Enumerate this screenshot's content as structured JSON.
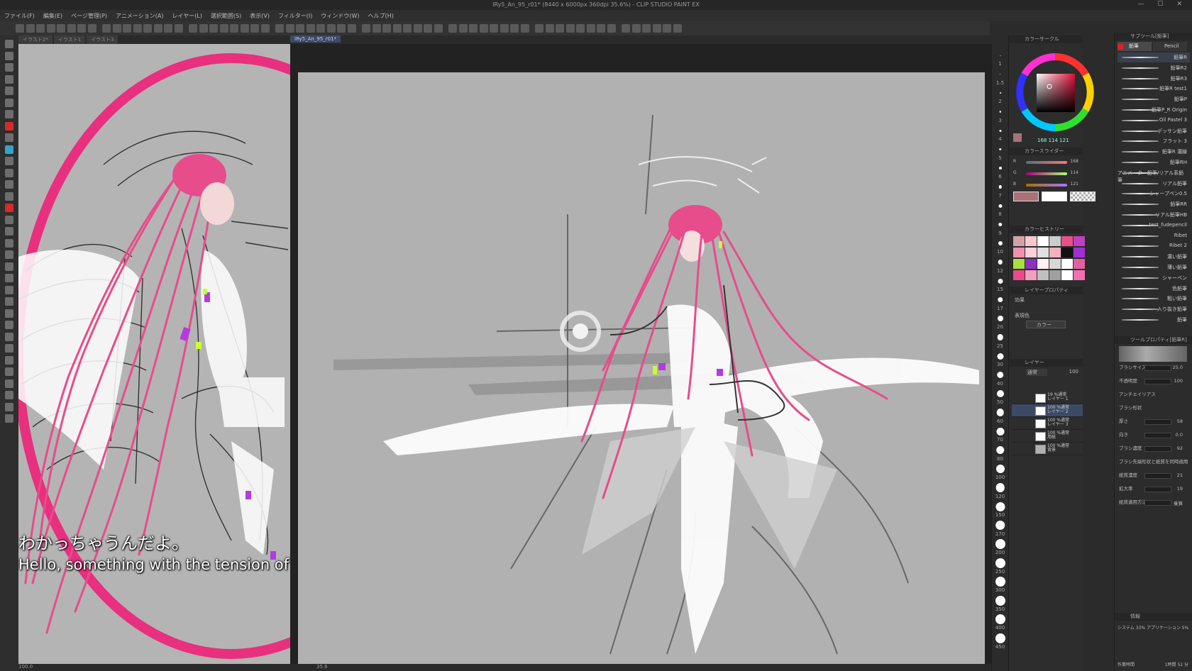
{
  "window": {
    "title": "IRy5_An_95_r01* (8440 x 6000px 360dpi 35.6%) - CLIP STUDIO PAINT EX",
    "controls": "— ☐ ✕"
  },
  "menu": [
    "ファイル(F)",
    "編集(E)",
    "ページ管理(P)",
    "アニメーション(A)",
    "レイヤー(L)",
    "選択範囲(S)",
    "表示(V)",
    "フィルター(I)",
    "ウィンドウ(W)",
    "ヘルプ(H)"
  ],
  "tabs": {
    "left": [
      "イラスト2*",
      "イラスト1",
      "イラスト3"
    ],
    "right": "IRy5_An_95_r01*"
  },
  "subtitles": {
    "jp": "わかっちゃうんだよ。",
    "en": "Hello, something with the tension of the day."
  },
  "brush_sizes": [
    "1",
    "1.5",
    "2",
    "3",
    "4",
    "5",
    "6",
    "7",
    "8",
    "9",
    "10",
    "12",
    "15",
    "17",
    "20",
    "25",
    "30",
    "40",
    "50",
    "60",
    "70",
    "80",
    "100",
    "120",
    "150",
    "170",
    "200",
    "250",
    "300",
    "350",
    "400",
    "450"
  ],
  "color_wheel": {
    "title": "カラーサークル",
    "current_color": "#a87279",
    "readout": "168 114 121"
  },
  "color_slider": {
    "title": "カラースライダー",
    "r_label": "R",
    "g_label": "G",
    "b_label": "B",
    "r": "168",
    "g": "114",
    "b": "121"
  },
  "color_history": {
    "title": "カラーヒストリー",
    "swatches": [
      "#d4a1a8",
      "#f5c9ce",
      "#ffffff",
      "#cccccc",
      "#e8508a",
      "#c040c0",
      "#f090b0",
      "#ffd0dc",
      "#e0e0e0",
      "#f4b0c0",
      "#111111",
      "#a030d0",
      "#a8e040",
      "#9030c0",
      "#fff0f4",
      "#d8d8d8",
      "#ffffff",
      "#e060a0",
      "#e84a8a",
      "#f0a0c0",
      "#c0c0c0",
      "#a0a0a0",
      "#ffffff",
      "#f070b0"
    ]
  },
  "layer_property": {
    "title": "レイヤープロパティ",
    "effect_label": "効果",
    "expression_label": "表現色",
    "expression_value": "カラー"
  },
  "layers": {
    "title": "レイヤー",
    "blend": "通常",
    "opacity": "100",
    "rows": [
      {
        "line1": "19 %通常",
        "line2": "レイヤー 1"
      },
      {
        "line1": "100 %通常",
        "line2": "レイヤー 2"
      },
      {
        "line1": "100 %通常",
        "line2": "レイヤー 3"
      },
      {
        "line1": "100 %通常",
        "line2": "用紙"
      },
      {
        "line1": "100 %通常",
        "line2": "背景"
      }
    ]
  },
  "subtool_group": {
    "title": "サブツール[鉛筆]",
    "tab1": "鉛筆",
    "tab2": "Pencil"
  },
  "brushes": [
    "鉛筆R",
    "鉛筆R2",
    "鉛筆R3",
    "鉛筆R test1",
    "鉛筆P",
    "鉛筆P_R Origin",
    "Oil Pastel 3",
    "デッサン鉛筆",
    "フラット 3",
    "鉛筆R 濃線",
    "鉛筆RH",
    "アニメーター鉛筆/リアル系鉛筆",
    "リアル鉛筆",
    "シャープペン0.5",
    "鉛筆RR",
    "リアル鉛筆HB",
    "test_fudepencil",
    "Ribet",
    "Ribet 2",
    "濃い鉛筆",
    "薄い鉛筆",
    "シャーペン",
    "色鉛筆",
    "粗い鉛筆",
    "入り抜き鉛筆",
    "鉛筆"
  ],
  "tool_property": {
    "title": "ツールプロパティ[鉛筆R]",
    "props": [
      {
        "label": "ブラシサイズ",
        "value": "25.0"
      },
      {
        "label": "不透明度",
        "value": "100"
      },
      {
        "label": "アンチエイリアス",
        "value": ""
      },
      {
        "label": "ブラシ形状",
        "value": ""
      },
      {
        "label": "厚さ",
        "value": "58"
      },
      {
        "label": "向き",
        "value": "0.0"
      },
      {
        "label": "ブラシ濃度",
        "value": "92"
      },
      {
        "label": "ブラシ先端形状と紙質を同時適用",
        "value": ""
      },
      {
        "label": "紙質濃度",
        "value": "21"
      },
      {
        "label": "拡大率",
        "value": "19"
      },
      {
        "label": "紙質適用方法",
        "value": "乗算"
      }
    ]
  },
  "info_panel": {
    "title": "情報",
    "line1": "システム 33%  アプリケーション 5%",
    "line2": "作業時間",
    "line3": "1時間 52 分"
  },
  "bottombar": {
    "left_zoom": "100.0",
    "right_zoom": "35.6"
  },
  "colors": {
    "accent": "#e8307f",
    "hair": "#e64d8a"
  }
}
